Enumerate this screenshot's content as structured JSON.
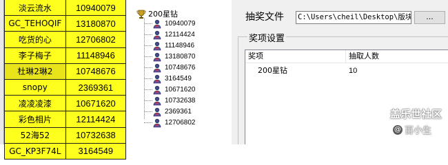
{
  "sheet": {
    "rows": [
      {
        "name": "淡云流水",
        "id": "10940079"
      },
      {
        "name": "GC_TEHOQIF",
        "id": "13180870"
      },
      {
        "name": "吃货的心",
        "id": "12706802"
      },
      {
        "name": "李子梅子",
        "id": "11148946"
      },
      {
        "name": "杜琳2琳2",
        "id": "10748676"
      },
      {
        "name": "snopy",
        "id": "2369361"
      },
      {
        "name": "凌凌凌漆",
        "id": "10671620"
      },
      {
        "name": "彩色相片",
        "id": "12114424"
      },
      {
        "name": "52海52",
        "id": "10732638"
      },
      {
        "name": "GC_KP3F74L",
        "id": "3164549"
      }
    ]
  },
  "tree": {
    "root_label": "200星钻",
    "root_icon": "trophy-icon",
    "leaf_icon": "person-icon",
    "items": [
      "10940079",
      "12114424",
      "11148946",
      "13180870",
      "10748676",
      "3164549",
      "10671620",
      "10732638",
      "2369361",
      "12706802"
    ]
  },
  "settings": {
    "file_label": "抽奖文件",
    "file_path": "C:\\Users\\cheil\\Desktop\\版块活",
    "browse_label": "...",
    "group_title": "奖项设置",
    "list": {
      "headers": [
        "奖项",
        "抽取人数"
      ],
      "rows": [
        {
          "prize": "200星钻",
          "count": "10"
        }
      ]
    }
  },
  "watermark": {
    "main": "盖乐世社区",
    "sub": "百小生"
  },
  "colors": {
    "cell_yellow": "#ffff1e",
    "panel_bg": "#f0f0f0"
  }
}
